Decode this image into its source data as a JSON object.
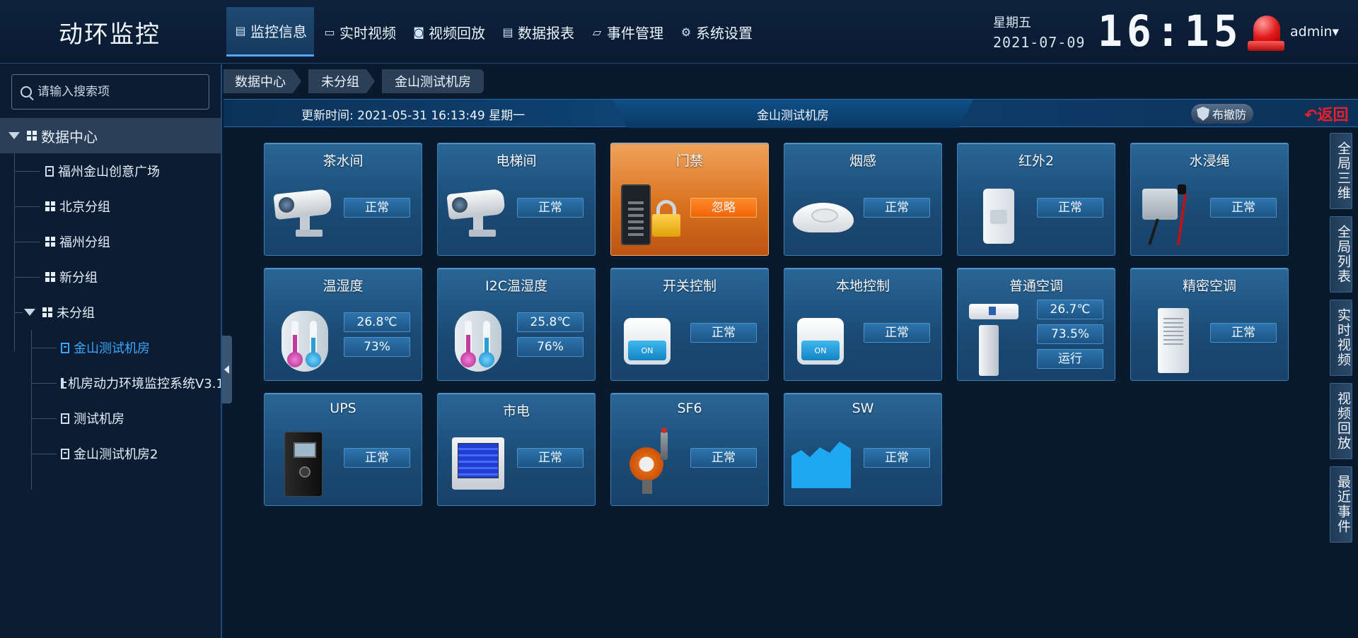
{
  "app": {
    "title": "动环监控"
  },
  "nav": [
    {
      "label": "监控信息",
      "icon": "monitor-doc-icon",
      "active": true
    },
    {
      "label": "实时视频",
      "icon": "video-camera-icon"
    },
    {
      "label": "视频回放",
      "icon": "camera-playback-icon"
    },
    {
      "label": "数据报表",
      "icon": "report-icon"
    },
    {
      "label": "事件管理",
      "icon": "folder-icon"
    },
    {
      "label": "系统设置",
      "icon": "gear-icon"
    }
  ],
  "clock": {
    "weekday": "星期五",
    "date": "2021-07-09",
    "time": "16:15"
  },
  "user": {
    "name": "admin▾"
  },
  "search": {
    "placeholder": "请输入搜索项"
  },
  "tree": {
    "root": "数据中心",
    "items": [
      {
        "label": "福州金山创意广场"
      },
      {
        "label": "北京分组"
      },
      {
        "label": "福州分组"
      },
      {
        "label": "新分组"
      },
      {
        "label": "未分组"
      },
      {
        "label": "金山测试机房",
        "selected": true
      },
      {
        "label": "机房动力环境监控系统V3.1"
      },
      {
        "label": "测试机房"
      },
      {
        "label": "金山测试机房2"
      }
    ]
  },
  "breadcrumb": [
    "数据中心",
    "未分组",
    "金山测试机房"
  ],
  "infobar": {
    "update": "更新时间: 2021-05-31 16:13:49 星期一",
    "room": "金山测试机房",
    "arm_label": "布撤防",
    "back_label": "返回"
  },
  "tiles": [
    {
      "title": "茶水间",
      "icon": "camera-icon",
      "status": [
        "正常"
      ]
    },
    {
      "title": "电梯间",
      "icon": "camera-icon",
      "status": [
        "正常"
      ]
    },
    {
      "title": "门禁",
      "icon": "access-control-icon",
      "status": [
        "忽略"
      ],
      "alert": true
    },
    {
      "title": "烟感",
      "icon": "smoke-detector-icon",
      "status": [
        "正常"
      ]
    },
    {
      "title": "红外2",
      "icon": "infrared-sensor-icon",
      "status": [
        "正常"
      ]
    },
    {
      "title": "水浸绳",
      "icon": "water-leak-sensor-icon",
      "status": [
        "正常"
      ]
    },
    {
      "title": "温湿度",
      "icon": "thermometer-icon",
      "status": [
        "26.8℃",
        "73%"
      ]
    },
    {
      "title": "I2C温湿度",
      "icon": "thermometer-icon",
      "status": [
        "25.8℃",
        "76%"
      ]
    },
    {
      "title": "开关控制",
      "icon": "switch-icon",
      "icon_label": "ON",
      "status": [
        "正常"
      ]
    },
    {
      "title": "本地控制",
      "icon": "switch-icon",
      "icon_label": "ON",
      "status": [
        "正常"
      ]
    },
    {
      "title": "普通空调",
      "icon": "air-conditioner-icon",
      "status": [
        "26.7℃",
        "73.5%",
        "运行"
      ]
    },
    {
      "title": "精密空调",
      "icon": "precision-ac-icon",
      "status": [
        "正常"
      ]
    },
    {
      "title": "UPS",
      "icon": "ups-icon",
      "status": [
        "正常"
      ]
    },
    {
      "title": "市电",
      "icon": "power-meter-icon",
      "status": [
        "正常"
      ]
    },
    {
      "title": "SF6",
      "icon": "sf6-detector-icon",
      "status": [
        "正常"
      ]
    },
    {
      "title": "SW",
      "icon": "area-chart-icon",
      "status": [
        "正常"
      ]
    }
  ],
  "side_tabs": [
    "全局三维",
    "全局列表",
    "实时视频",
    "视频回放",
    "最近事件"
  ],
  "colors": {
    "accent": "#3aa7ff",
    "alert_tile": "#d9721f",
    "back": "#e8202c"
  }
}
